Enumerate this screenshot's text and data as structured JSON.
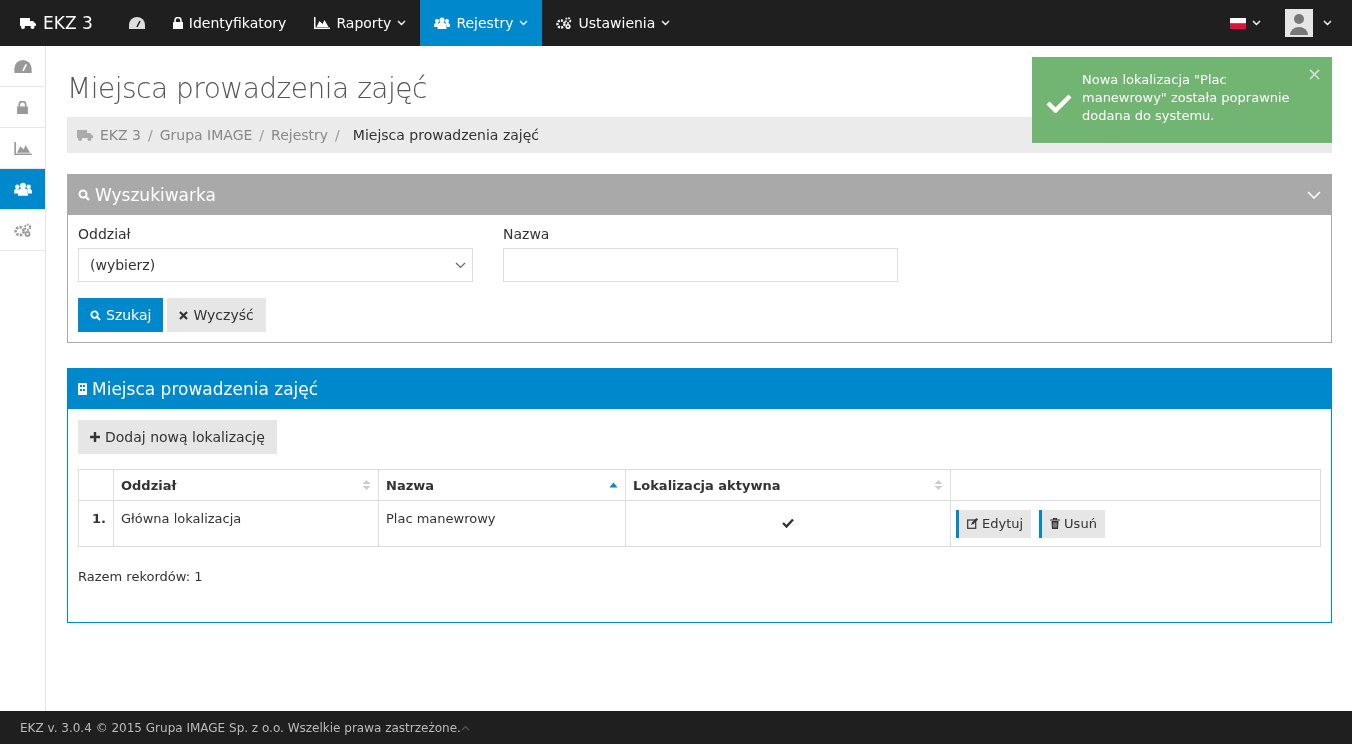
{
  "navbar": {
    "brand": "EKZ 3",
    "items": [
      {
        "dropdown": false,
        "selected": false
      },
      {
        "label": "Identyfikatory",
        "dropdown": false,
        "selected": false
      },
      {
        "label": "Raporty",
        "dropdown": true,
        "selected": false
      },
      {
        "label": "Rejestry",
        "dropdown": true,
        "selected": true
      },
      {
        "label": "Ustawienia",
        "dropdown": true,
        "selected": false
      }
    ]
  },
  "sidebar": {
    "items": [
      {
        "selected": false
      },
      {
        "selected": false
      },
      {
        "selected": false
      },
      {
        "selected": true
      },
      {
        "selected": false
      }
    ]
  },
  "page_title": "Miejsca prowadzenia zajęć",
  "breadcrumb": {
    "separator": "/",
    "items": [
      "EKZ 3",
      "Grupa IMAGE",
      "Rejestry",
      "Miejsca prowadzenia zajęć"
    ]
  },
  "notification": {
    "message": "Nowa lokalizacja \"Plac manewrowy\" została poprawnie dodana do systemu.",
    "close": "×"
  },
  "search_panel": {
    "title": "Wyszukiwarka",
    "expanded": true,
    "fields": [
      {
        "kind": "select",
        "label": "Oddział",
        "value": "(wybierz)"
      },
      {
        "kind": "text",
        "label": "Nazwa"
      }
    ],
    "buttons": [
      {
        "label": "Szukaj",
        "kind": "primary"
      },
      {
        "label": "Wyczyść",
        "kind": "default"
      }
    ]
  },
  "list_panel": {
    "title": "Miejsca prowadzenia zajęć",
    "add_button": "Dodaj nową lokalizację",
    "columns": [
      {
        "sortable": false
      },
      {
        "label": "Oddział",
        "sortable": true,
        "selected": false
      },
      {
        "label": "Nazwa",
        "sortable": true,
        "selected": true
      },
      {
        "label": "Lokalizacja aktywna",
        "sortable": true,
        "selected": false
      },
      {
        "sortable": false
      }
    ],
    "rows": [
      {
        "number": "1.",
        "oddzial": "Główna lokalizacja",
        "nazwa": "Plac manewrowy",
        "active": true,
        "actions": [
          {
            "label": "Edytuj",
            "kind": "edit"
          },
          {
            "label": "Usuń",
            "kind": "delete"
          }
        ]
      }
    ],
    "total": "Razem rekordów: 1"
  },
  "footer": "EKZ v. 3.0.4 © 2015 Grupa IMAGE Sp. z o.o. Wszelkie prawa zastrzeżone."
}
